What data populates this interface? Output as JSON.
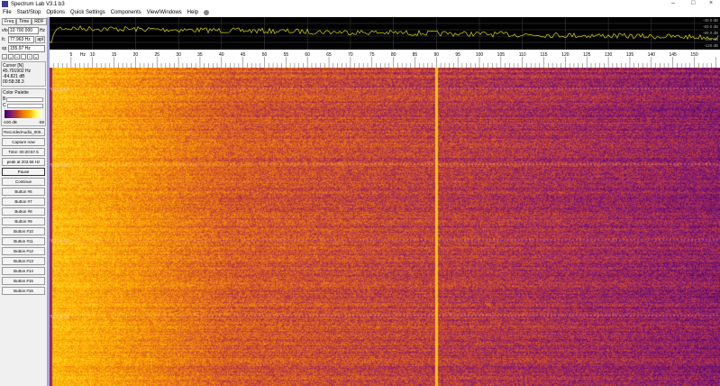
{
  "window": {
    "title": "Spectrum Lab V3.1 b3",
    "controls": [
      "–",
      "□",
      "×"
    ]
  },
  "menu": [
    "File",
    "Start/Stop",
    "Options",
    "Quick Settings",
    "Components",
    "View/Windows",
    "Help"
  ],
  "left": {
    "tabs": [
      "Freq",
      "Time",
      "RDF"
    ],
    "vfo": {
      "label": "vfo",
      "value": "10 700 000",
      "unit": "Hz"
    },
    "fc": {
      "label": "fc",
      "value": "77.963 Hz",
      "button": "apl"
    },
    "sp": {
      "label": "sp",
      "value": "155.97 Hz"
    },
    "arrows": [
      "<",
      ">",
      "+",
      "-",
      "*",
      "v"
    ],
    "cursor": {
      "title": "Cursor [N]",
      "freq": "45.791902 Hz",
      "level": "-84.821 dB",
      "time": "00:58:38.3"
    },
    "palette": {
      "title": "Color Palette",
      "b_label": "B",
      "c_label": "C",
      "min": "-100 dB",
      "max": "-58"
    },
    "buttons": [
      "RecordedAudio_000..",
      "Capture now",
      "Time:  00:20:57.5",
      "peak at 203.56 Hz",
      "Pause",
      "Continue",
      "Button #6",
      "Button #7",
      "Button #8",
      "Button #9",
      "Button #10",
      "Button #11",
      "Button #12",
      "Button #13",
      "Button #14",
      "Button #15",
      "Button #16"
    ]
  },
  "spectrum": {
    "db_labels": [
      "-40.0 dB",
      "-60.0 dB",
      "-80.0 dB",
      "-100 dB",
      "-120 dB"
    ],
    "line_color": "#d8d800"
  },
  "axis": {
    "unit": "Hz",
    "ticks": [
      5,
      10,
      15,
      20,
      25,
      30,
      35,
      40,
      45,
      50,
      55,
      60,
      65,
      70,
      75,
      80,
      85,
      90,
      95,
      100,
      105,
      110,
      115,
      120,
      125,
      130,
      135,
      140,
      145,
      150
    ]
  },
  "waterfall": {
    "timestamps": [
      "01:16:00",
      "01:10:00",
      "01:04:00",
      "00:58:00"
    ],
    "marker_freq_hz": 90
  }
}
